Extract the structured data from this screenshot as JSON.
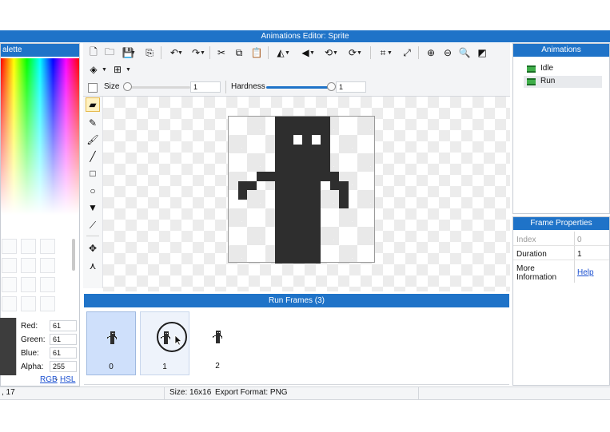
{
  "window": {
    "title": "Animations Editor: Sprite"
  },
  "palette": {
    "title": "alette"
  },
  "toolbar": {
    "icons": [
      "new-file-icon",
      "open-folder-icon",
      "save-icon",
      "export-icon",
      "undo-icon",
      "redo-icon",
      "cut-icon",
      "copy-icon",
      "paste-icon",
      "flip-horizontal-icon",
      "flip-vertical-icon",
      "rotate-left-icon",
      "rotate-right-icon",
      "crop-icon",
      "resize-icon",
      "zoom-in-icon",
      "zoom-out-icon",
      "zoom-fit-icon",
      "invert-icon",
      "layers-icon",
      "grid-icon"
    ],
    "size_label": "Size",
    "size_value": "1",
    "size_level": 0.0,
    "hardness_label": "Hardness",
    "hardness_value": "1",
    "hardness_level": 1.0
  },
  "tools": [
    "eraser-icon",
    "pencil-icon",
    "brush-icon",
    "line-icon",
    "rectangle-icon",
    "ellipse-icon",
    "fill-bucket-icon",
    "eyedropper-icon",
    "move-icon",
    "transform-icon"
  ],
  "color": {
    "red_label": "Red:",
    "red": "61",
    "green_label": "Green:",
    "green": "61",
    "blue_label": "Blue:",
    "blue": "61",
    "alpha_label": "Alpha:",
    "alpha": "255",
    "rgb_link": "RGB",
    "hsl_link": "HSL",
    "mode_sep": "-",
    "swatch": "#3d3d3d"
  },
  "animations": {
    "title": "Animations",
    "items": [
      {
        "label": "Idle",
        "selected": false
      },
      {
        "label": "Run",
        "selected": true
      }
    ]
  },
  "frame_properties": {
    "title": "Frame Properties",
    "index_label": "Index",
    "index_value": "0",
    "duration_label": "Duration",
    "duration_value": "1",
    "more_label_1": "More",
    "more_label_2": "Information",
    "help_link": "Help"
  },
  "frames": {
    "title": "Run Frames (3)",
    "items": [
      {
        "label": "0"
      },
      {
        "label": "1"
      },
      {
        "label": "2"
      }
    ]
  },
  "status": {
    "coords": ", 17",
    "size": "Size: 16x16",
    "format": "Export Format: PNG"
  },
  "colors": {
    "accent": "#1f73c8",
    "sprite": "#2e2e2e",
    "selected_frame": "#cfe0fb"
  }
}
